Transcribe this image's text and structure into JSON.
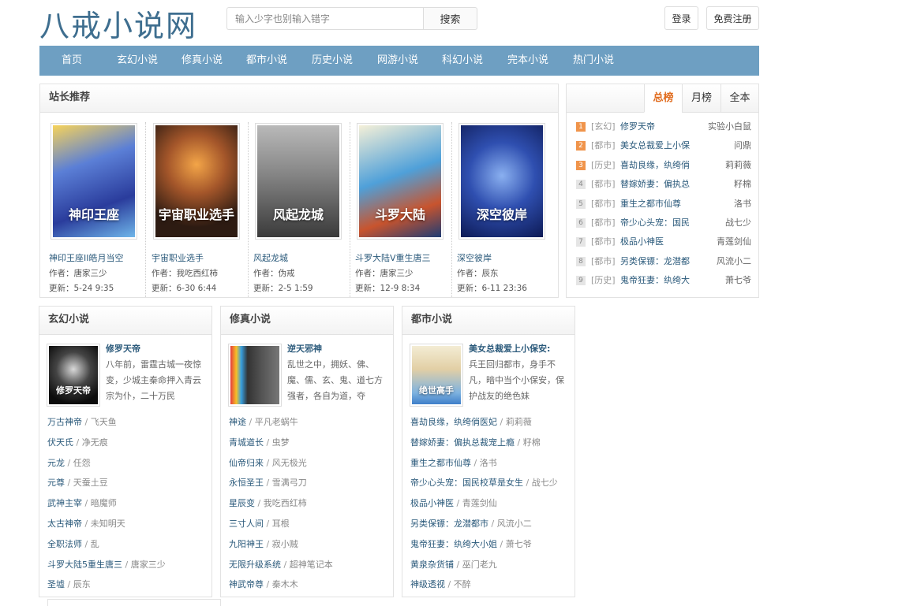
{
  "header": {
    "logo": "八戒小说网",
    "search_placeholder": "输入少字也别输入错字",
    "search_button": "搜索",
    "login": "登录",
    "register": "免费注册"
  },
  "nav": [
    "首页",
    "玄幻小说",
    "修真小说",
    "都市小说",
    "历史小说",
    "网游小说",
    "科幻小说",
    "完本小说",
    "热门小说"
  ],
  "recommend": {
    "title": "站长推荐",
    "author_prefix": "作者：",
    "update_prefix": "更新：",
    "books": [
      {
        "title": "神印王座II皓月当空",
        "author": "唐家三少",
        "updated": "5-24 9:35",
        "cover_text": "神印王座",
        "cover": "cover-a"
      },
      {
        "title": "宇宙职业选手",
        "author": "我吃西红柿",
        "updated": "6-30 6:44",
        "cover_text": "宇宙职业选手",
        "cover": "cover-b"
      },
      {
        "title": "风起龙城",
        "author": "伪戒",
        "updated": "2-5 1:59",
        "cover_text": "风起龙城",
        "cover": "cover-c"
      },
      {
        "title": "斗罗大陆V重生唐三",
        "author": "唐家三少",
        "updated": "12-9 8:34",
        "cover_text": "斗罗大陆",
        "cover": "cover-d"
      },
      {
        "title": "深空彼岸",
        "author": "辰东",
        "updated": "6-11 23:36",
        "cover_text": "深空彼岸",
        "cover": "cover-e"
      }
    ]
  },
  "rank": {
    "tabs": [
      "总榜",
      "月榜",
      "全本"
    ],
    "active_tab": "总榜",
    "items": [
      {
        "num": "1",
        "cat": "[玄幻]",
        "name": "修罗天帝",
        "author": "实验小白鼠"
      },
      {
        "num": "2",
        "cat": "[都市]",
        "name": "美女总裁爱上小保",
        "author": "问鼎"
      },
      {
        "num": "3",
        "cat": "[历史]",
        "name": "喜劫良缘，纨绔俏",
        "author": "莉莉薇"
      },
      {
        "num": "4",
        "cat": "[都市]",
        "name": "替嫁娇妻：偏执总",
        "author": "籽棉"
      },
      {
        "num": "5",
        "cat": "[都市]",
        "name": "重生之都市仙尊",
        "author": "洛书"
      },
      {
        "num": "6",
        "cat": "[都市]",
        "name": "帝少心头宠：国民",
        "author": "战七少"
      },
      {
        "num": "7",
        "cat": "[都市]",
        "name": "极品小神医",
        "author": "青莲剑仙"
      },
      {
        "num": "8",
        "cat": "[都市]",
        "name": "另类保镖：龙潜都",
        "author": "风流小二"
      },
      {
        "num": "9",
        "cat": "[历史]",
        "name": "鬼帝狂妻：纨绔大",
        "author": "萧七爷"
      }
    ]
  },
  "categories": [
    {
      "title": "玄幻小说",
      "featured": {
        "title": "修罗天帝",
        "desc": "八年前，雷霆古城一夜惊变，少城主秦命押入青云宗为仆，二十万民",
        "cover": "cover-f",
        "cover_text": "修罗天帝"
      },
      "list": [
        {
          "name": "万古神帝",
          "author": "飞天鱼"
        },
        {
          "name": "伏天氏",
          "author": "净无痕"
        },
        {
          "name": "元龙",
          "author": "任怨"
        },
        {
          "name": "元尊",
          "author": "天蚕土豆"
        },
        {
          "name": "武神主宰",
          "author": "暗魔师"
        },
        {
          "name": "太古神帝",
          "author": "未知明天"
        },
        {
          "name": "全职法师",
          "author": "乱"
        },
        {
          "name": "斗罗大陆5重生唐三",
          "author": "唐家三少"
        },
        {
          "name": "圣墟",
          "author": "辰东"
        }
      ]
    },
    {
      "title": "修真小说",
      "featured": {
        "title": "逆天邪神",
        "desc": "乱世之中，拥妖、佛、魔、儒、玄、鬼、道七方强者，各自为道，夺",
        "cover": "cover-g",
        "cover_text": ""
      },
      "list": [
        {
          "name": "神途",
          "author": "平凡老蜗牛"
        },
        {
          "name": "青城道长",
          "author": "虫梦"
        },
        {
          "name": "仙帝归来",
          "author": "风无极光"
        },
        {
          "name": "永恒圣王",
          "author": "雪满弓刀"
        },
        {
          "name": "星辰变",
          "author": "我吃西红柿"
        },
        {
          "name": "三寸人间",
          "author": "耳根"
        },
        {
          "name": "九阳神王",
          "author": "寂小贼"
        },
        {
          "name": "无限升级系统",
          "author": "超神笔记本"
        },
        {
          "name": "神武帝尊",
          "author": "秦木木"
        }
      ]
    },
    {
      "title": "都市小说",
      "featured": {
        "title": "美女总裁爱上小保安:",
        "desc": "兵王回归都市，身手不凡，暗中当个小保安，保护战友的绝色妹",
        "cover": "cover-h",
        "cover_text": "绝世高手"
      },
      "list": [
        {
          "name": "喜劫良缘，纨绔俏医妃",
          "author": "莉莉薇"
        },
        {
          "name": "替嫁娇妻：偏执总裁宠上瘾",
          "author": "籽棉"
        },
        {
          "name": "重生之都市仙尊",
          "author": "洛书"
        },
        {
          "name": "帝少心头宠：国民校草是女生",
          "author": "战七少"
        },
        {
          "name": "极品小神医",
          "author": "青莲剑仙"
        },
        {
          "name": "另类保镖：龙潜都市",
          "author": "风流小二"
        },
        {
          "name": "鬼帝狂妻：纨绔大小姐",
          "author": "萧七爷"
        },
        {
          "name": "黄泉杂货铺",
          "author": "巫门老九"
        },
        {
          "name": "神级透视",
          "author": "不醉"
        }
      ]
    }
  ],
  "colors": {
    "nav_bg": "#6e9fc2",
    "logo": "#3e6e8f",
    "link": "#2b5a7b",
    "rank_top": "#f0944b",
    "rank_other": "#e5e5e5",
    "active_tab": "#e06b1d"
  }
}
